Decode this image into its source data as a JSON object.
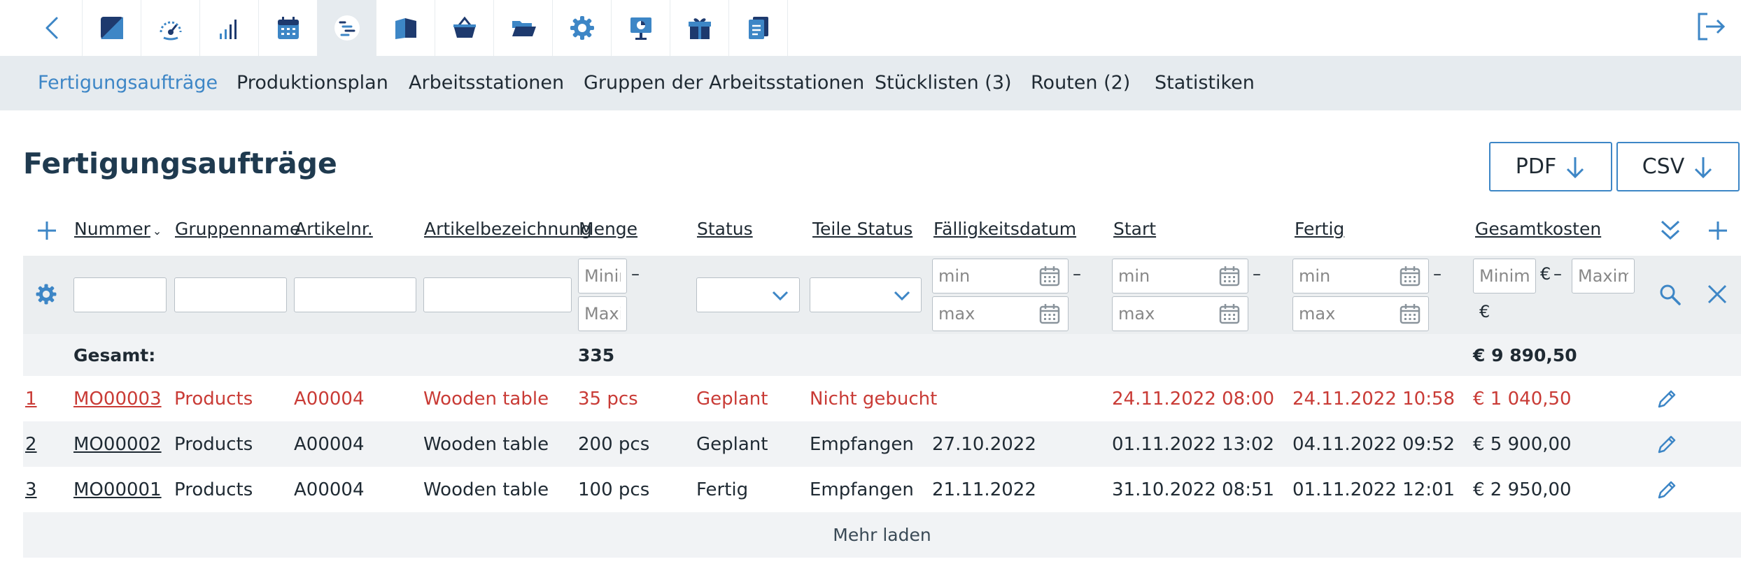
{
  "colors": {
    "accent": "#3d86c6",
    "navy": "#1e3a6e",
    "red": "#c93b36",
    "text": "#1f2a33",
    "band": "#e6ebef"
  },
  "topbar": {
    "icons": [
      "back-icon",
      "brand-icon",
      "dashboard-icon",
      "signal-icon",
      "calendar-icon",
      "production-icon",
      "book-icon",
      "basket-icon",
      "folder-icon",
      "gear-icon",
      "presentation-icon",
      "gift-icon",
      "documents-icon",
      "logout-icon"
    ],
    "active": "production-icon"
  },
  "subnav": {
    "items": [
      "Fertigungsaufträge",
      "Produktionsplan",
      "Arbeitsstationen",
      "Gruppen der Arbeitsstationen",
      "Stücklisten (3)",
      "Routen (2)",
      "Statistiken"
    ],
    "active": 0
  },
  "page": {
    "title": "Fertigungsaufträge",
    "pdf_label": "PDF",
    "csv_label": "CSV"
  },
  "table": {
    "headers": [
      "Nummer",
      "Gruppenname",
      "Artikelnr.",
      "Artikelbezeichnung",
      "Menge",
      "Status",
      "Teile Status",
      "Fälligkeitsdatum",
      "Start",
      "Fertig",
      "Gesamtkosten"
    ],
    "sort_column": "Nummer",
    "filters": {
      "menge_min": "Minimum",
      "menge_max": "Maximum",
      "date_min": "min",
      "date_max": "max",
      "cost_min": "Minimum",
      "cost_max": "Maximum",
      "dash": "–",
      "euro": "€"
    },
    "totals": {
      "label": "Gesamt:",
      "menge": "335",
      "cost": "€ 9 890,50"
    },
    "rows": [
      {
        "idx": "1",
        "nummer": "MO00003",
        "gruppe": "Products",
        "artikelnr": "A00004",
        "bezeichnung": "Wooden table",
        "menge": "35 pcs",
        "status": "Geplant",
        "teile": "Nicht gebucht",
        "faellig": "",
        "start": "24.11.2022 08:00",
        "fertig": "24.11.2022 10:58",
        "kosten": "€ 1 040,50",
        "highlight": true
      },
      {
        "idx": "2",
        "nummer": "MO00002",
        "gruppe": "Products",
        "artikelnr": "A00004",
        "bezeichnung": "Wooden table",
        "menge": "200 pcs",
        "status": "Geplant",
        "teile": "Empfangen",
        "faellig": "27.10.2022",
        "start": "01.11.2022 13:02",
        "fertig": "04.11.2022 09:52",
        "kosten": "€ 5 900,00",
        "highlight": false
      },
      {
        "idx": "3",
        "nummer": "MO00001",
        "gruppe": "Products",
        "artikelnr": "A00004",
        "bezeichnung": "Wooden table",
        "menge": "100 pcs",
        "status": "Fertig",
        "teile": "Empfangen",
        "faellig": "21.11.2022",
        "start": "31.10.2022 08:51",
        "fertig": "01.11.2022 12:01",
        "kosten": "€ 2 950,00",
        "highlight": false
      }
    ],
    "load_more": "Mehr laden"
  }
}
